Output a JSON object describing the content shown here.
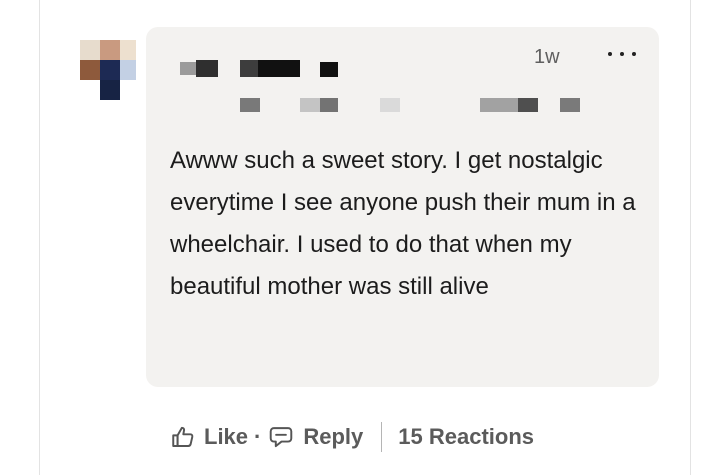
{
  "comment": {
    "timestamp": "1w",
    "more_icon": "more-horizontal-icon",
    "text": "Awww such a sweet story. I get nostalgic everytime I see anyone push their mum in a wheelchair. I used to do that when my beautiful mother was still alive"
  },
  "actions": {
    "like_icon": "thumbs-up-icon",
    "like_label": "Like",
    "separator": "·",
    "reply_icon": "speech-bubble-icon",
    "reply_label": "Reply",
    "reactions_label": "15 Reactions"
  },
  "colors": {
    "bubble_bg": "#f3f2f0",
    "text": "#1c1c1c",
    "muted": "#5b5b5b"
  }
}
